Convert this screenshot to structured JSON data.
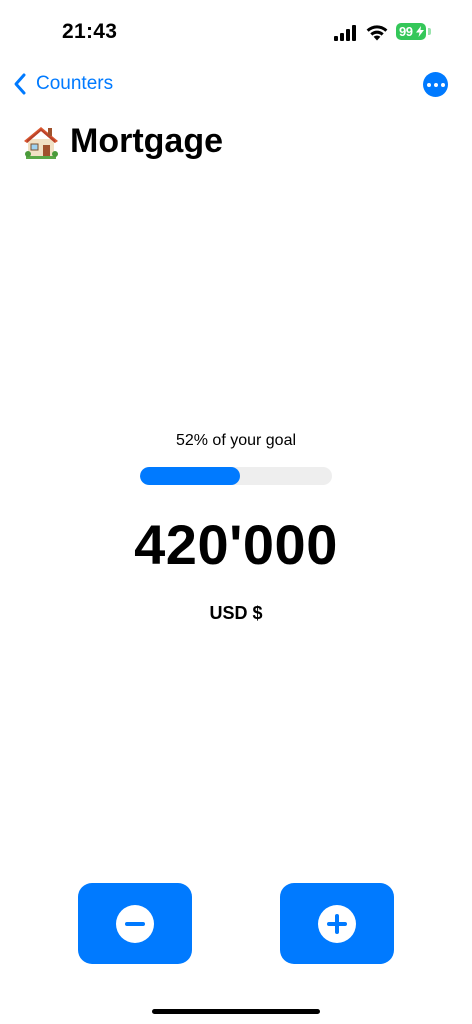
{
  "status_bar": {
    "time": "21:43",
    "battery_level": "99",
    "battery_color": "#34c759"
  },
  "nav": {
    "back_label": "Counters",
    "back_icon": "chevron-left-icon",
    "more_icon": "ellipsis-circle-icon"
  },
  "counter": {
    "title": "Mortgage",
    "icon": "house-emoji",
    "goal_text": "52% of your goal",
    "progress_fraction": 0.52,
    "value": "420'000",
    "currency": "USD $"
  },
  "actions": {
    "decrement_icon": "minus-circle-icon",
    "increment_icon": "plus-circle-icon"
  },
  "colors": {
    "accent": "#007aff",
    "track": "#eeeeee"
  }
}
